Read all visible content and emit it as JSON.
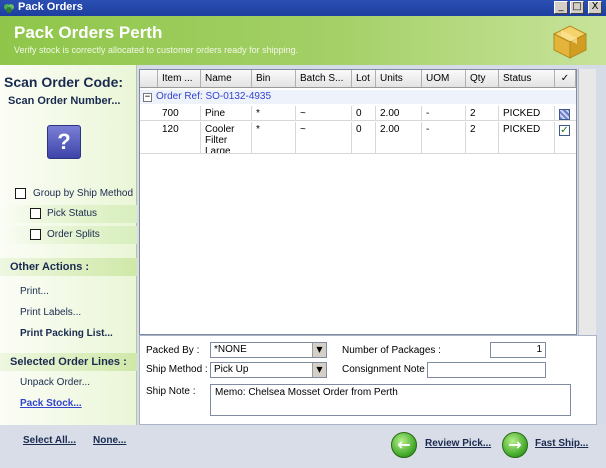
{
  "window": {
    "title": "Pack Orders",
    "controls": {
      "minimize": "_",
      "maximize": "□",
      "close": "X"
    }
  },
  "header": {
    "title": "Pack Orders Perth",
    "subtitle": "Verify stock is correctly allocated to customer orders ready for shipping.",
    "icon": "box-icon"
  },
  "sidebar": {
    "scan_title": "Scan Order Code:",
    "scan_sub": "Scan Order Number...",
    "help_label": "?",
    "group_by_ship_method": "Group by Ship Method",
    "pick_status": "Pick Status",
    "order_splits": "Order Splits",
    "other_actions_title": "Other Actions :",
    "print": "Print...",
    "print_labels": "Print Labels...",
    "print_packing_list": "Print Packing List...",
    "selected_lines_title": "Selected Order Lines :",
    "unpack_order": "Unpack Order...",
    "pack_stock": "Pack Stock..."
  },
  "grid": {
    "columns": [
      "Item ...",
      "Name",
      "Bin",
      "Batch S...",
      "Lot",
      "Units",
      "UOM",
      "Qty",
      "Status"
    ],
    "check_header": "✓",
    "group_toggle": "−",
    "group_label": "Order Ref: SO-0132-4935",
    "rows": [
      {
        "item": "700",
        "name": "Pine",
        "bin": "*",
        "batch": "~",
        "lot": "0",
        "units": "2.00",
        "uom": "-",
        "qty": "2",
        "status": "PICKED",
        "checked": ""
      },
      {
        "item": "120",
        "name": "Cooler Filter Large",
        "bin": "*",
        "batch": "~",
        "lot": "0",
        "units": "2.00",
        "uom": "-",
        "qty": "2",
        "status": "PICKED",
        "checked": "✓"
      }
    ]
  },
  "form": {
    "packed_by_label": "Packed By :",
    "packed_by_value": "*NONE",
    "ship_method_label": "Ship Method :",
    "ship_method_value": "Pick Up",
    "num_packages_label": "Number of Packages :",
    "num_packages_value": "1",
    "consignment_label": "Consignment Note :",
    "consignment_value": "",
    "ship_note_label": "Ship Note :",
    "ship_note_value": "Memo: Chelsea Mosset Order from Perth",
    "dropdown_arrow": "▼"
  },
  "footer": {
    "select_all": "Select All...",
    "none": "None...",
    "review_pick": "Review Pick...",
    "fast_ship": "Fast Ship...",
    "back_arrow": "←",
    "forward_arrow": "→"
  },
  "colors": {
    "header_green": "#a4d067",
    "titlebar_blue": "#2a4fb3",
    "link_blue": "#3344cc",
    "status_green": "#3ba423"
  }
}
